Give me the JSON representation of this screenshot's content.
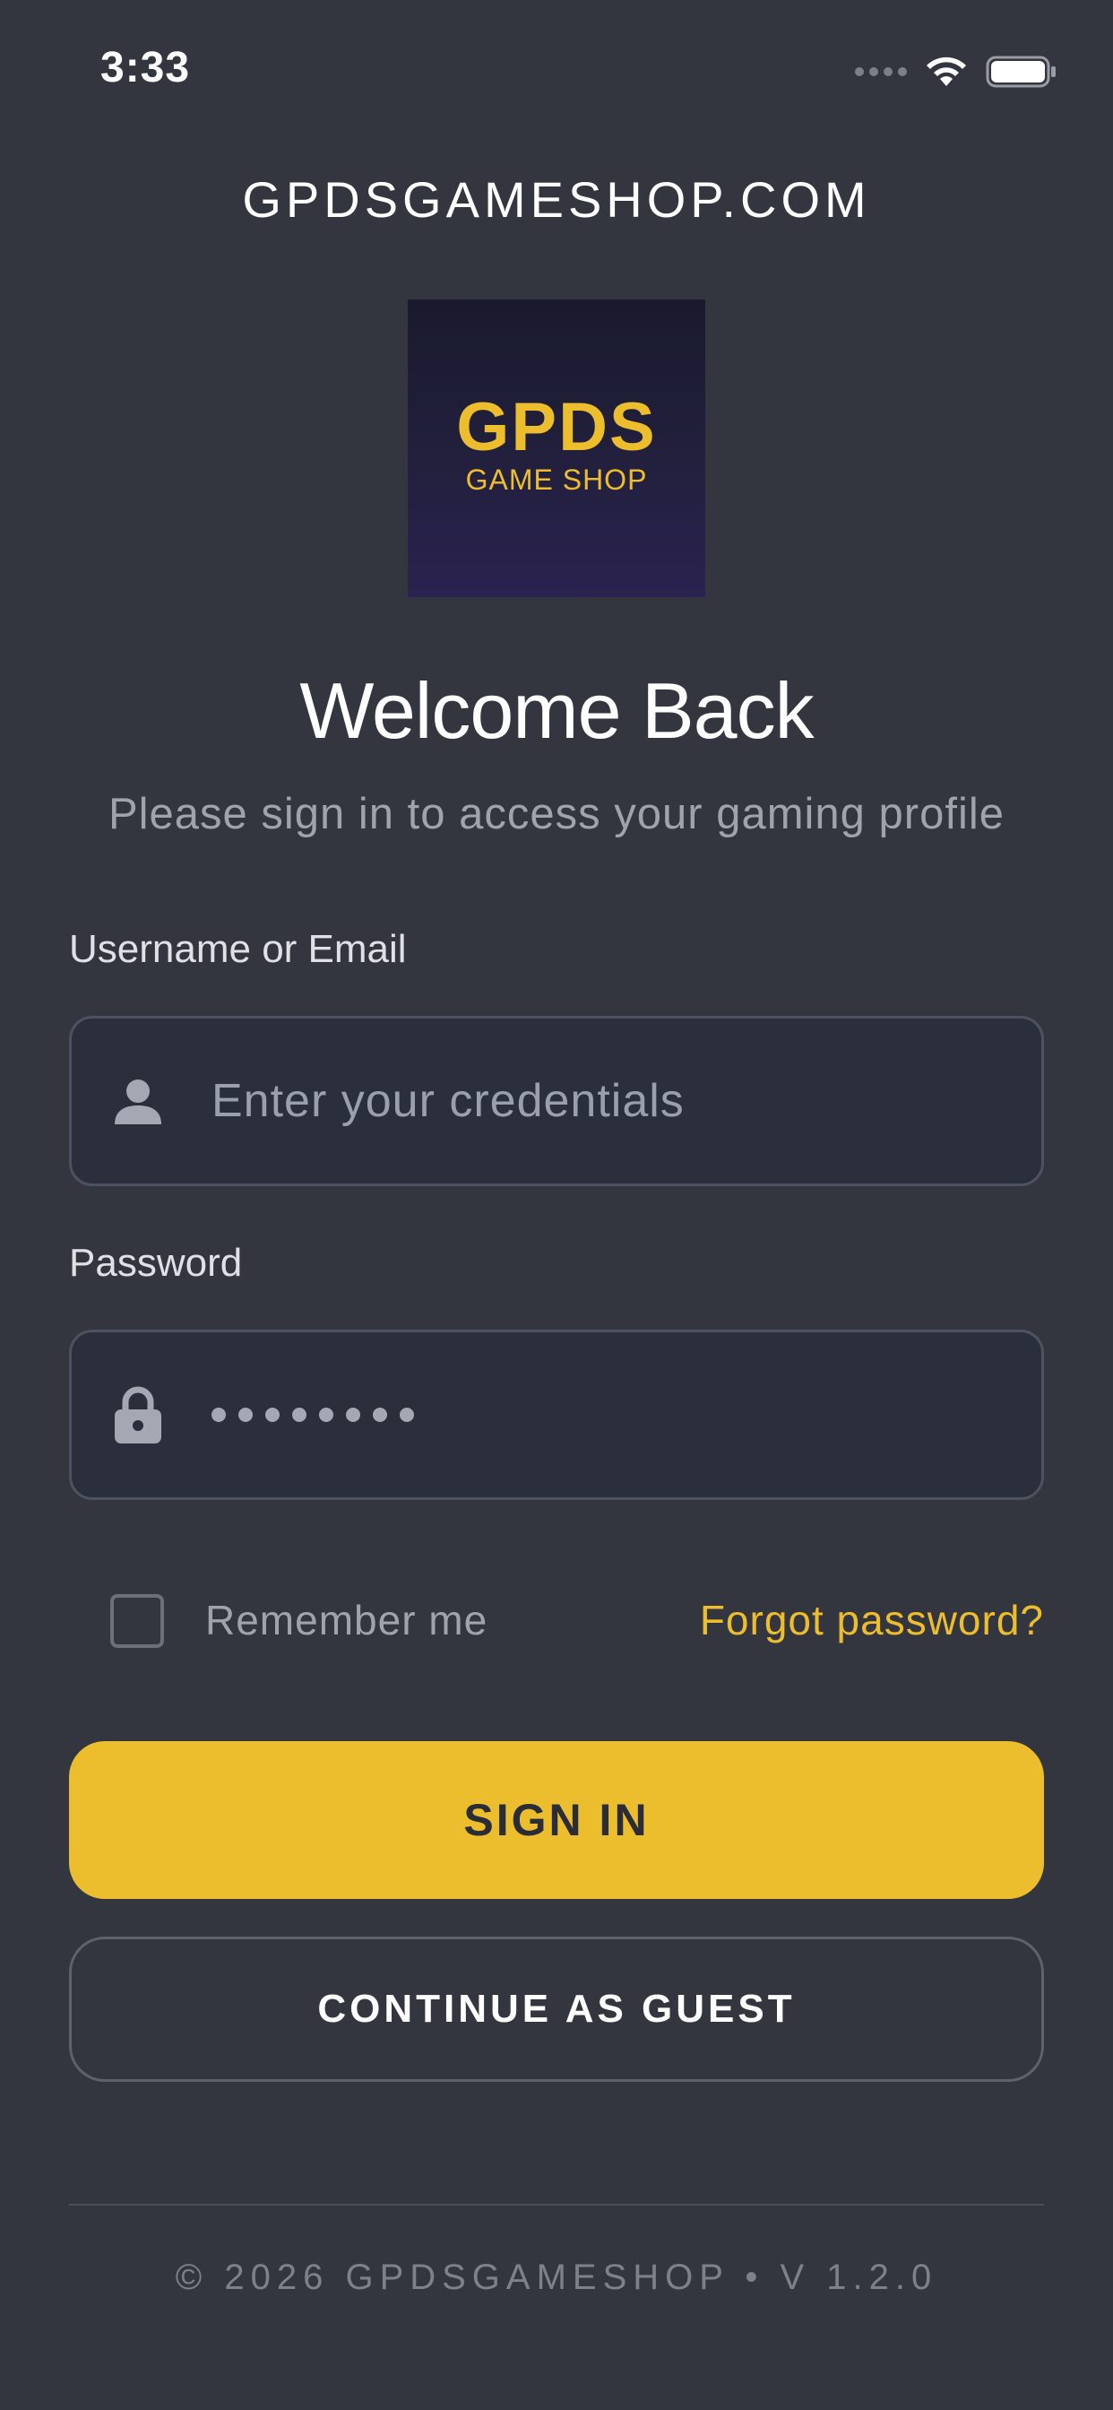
{
  "status_bar": {
    "time": "3:33",
    "icons": [
      "cellular-signal-icon",
      "wifi-icon",
      "battery-icon"
    ]
  },
  "header": {
    "site_title": "GPDSGAMESHOP.COM",
    "logo": {
      "line1": "GPDS",
      "line2": "GAME SHOP",
      "brand_color": "#ecbd2c"
    }
  },
  "welcome": {
    "title": "Welcome Back",
    "subtitle": "Please sign in to access your gaming profile"
  },
  "form": {
    "username": {
      "label": "Username or Email",
      "placeholder": "Enter your credentials",
      "icon": "user-icon"
    },
    "password": {
      "label": "Password",
      "masked_length": 8,
      "icon": "lock-icon"
    },
    "remember_me": {
      "label": "Remember me",
      "checked": false
    },
    "forgot_password": "Forgot password?"
  },
  "actions": {
    "sign_in": "SIGN IN",
    "guest": "CONTINUE AS GUEST"
  },
  "footer": {
    "text": "© 2026 GPDSGAMESHOP • V 1.2.0"
  },
  "colors": {
    "background": "#33363e",
    "accent": "#ecbd2c",
    "input_bg": "#2a2f3b",
    "muted_text": "#9fa3ad"
  }
}
